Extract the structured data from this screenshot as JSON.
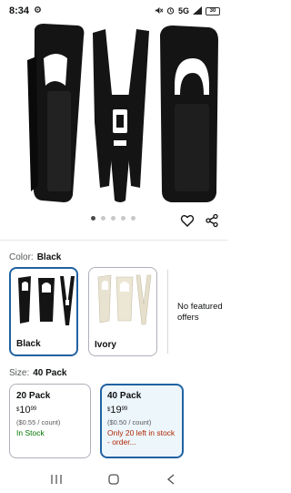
{
  "status_bar": {
    "time": "8:34",
    "network": "5G",
    "battery": "30"
  },
  "carousel": {
    "image_count": 5,
    "active_index": 0
  },
  "color_selector": {
    "label": "Color:",
    "selected": "Black",
    "options": [
      {
        "name": "Black"
      },
      {
        "name": "Ivory"
      }
    ],
    "no_featured_offers": "No featured offers"
  },
  "size_selector": {
    "label": "Size:",
    "selected": "40 Pack",
    "options": [
      {
        "name": "20 Pack",
        "currency": "$",
        "dollars": "10",
        "cents": "99",
        "unit_price": "($0.55 / count)",
        "availability": "In Stock"
      },
      {
        "name": "40 Pack",
        "currency": "$",
        "dollars": "19",
        "cents": "99",
        "unit_price": "($0.50 / count)",
        "availability": "Only 20 left in stock - order..."
      }
    ]
  },
  "colors": {
    "accent": "#2162a1",
    "in_stock": "#007600",
    "low_stock": "#b12704"
  },
  "icons": {
    "wishlist": "heart-icon",
    "share": "share-icon",
    "nav_recents": "recents-icon",
    "nav_home": "home-icon",
    "nav_back": "back-icon"
  }
}
